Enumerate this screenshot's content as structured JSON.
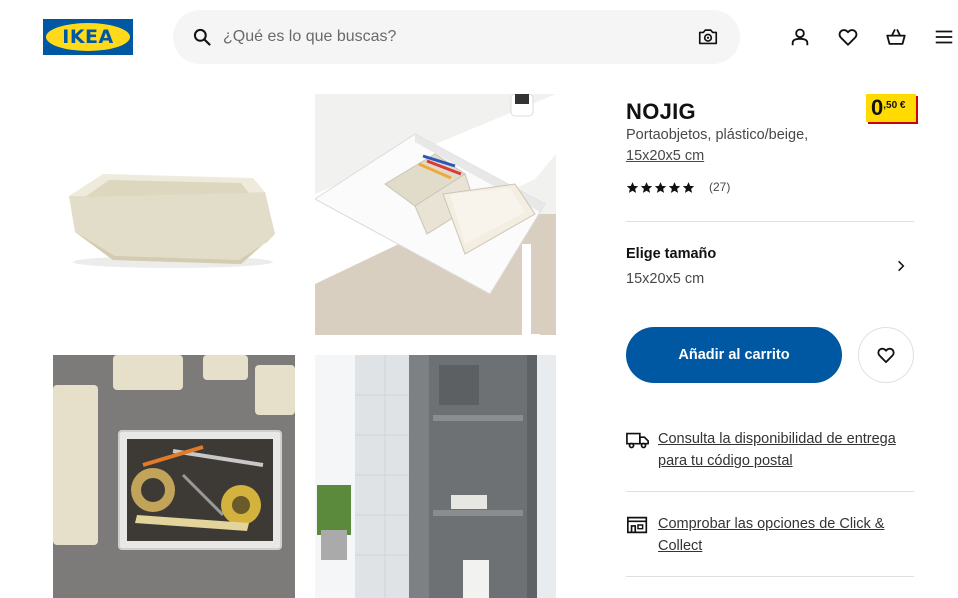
{
  "header": {
    "logo_text": "IKEA",
    "search_placeholder": "¿Qué es lo que buscas?",
    "icons": [
      "search-icon",
      "camera-icon",
      "user-icon",
      "heart-icon",
      "basket-icon",
      "menu-icon"
    ]
  },
  "product": {
    "name": "NOJIG",
    "description": "Portaobjetos, plástico/beige,",
    "size_link": "15x20x5 cm",
    "price_integer": "0",
    "price_decimal": ",50 €",
    "rating": 5,
    "review_count": "(27)"
  },
  "size_selector": {
    "title": "Elige tamaño",
    "value": "15x20x5 cm"
  },
  "actions": {
    "add_to_cart": "Añadir al carrito"
  },
  "delivery": {
    "check_delivery": "Consulta la disponibilidad de entrega para tu código postal",
    "click_collect": "Comprobar las opciones de Click & Collect"
  },
  "colors": {
    "ikea_blue": "#0058a3",
    "ikea_yellow": "#ffda1a",
    "price_red": "#cc0008"
  }
}
